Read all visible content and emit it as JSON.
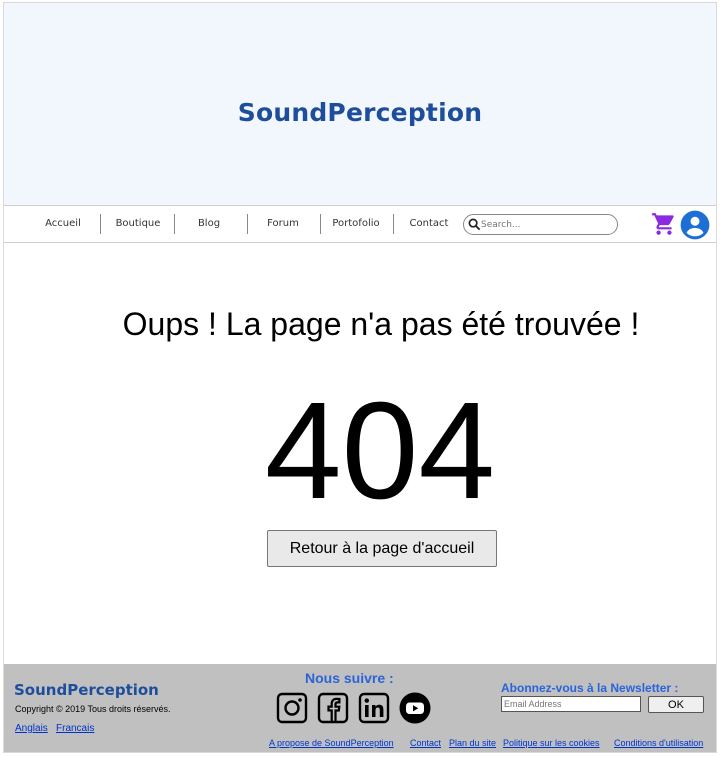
{
  "header": {
    "brand": "SoundPerception"
  },
  "nav": {
    "items": [
      "Accueil",
      "Boutique",
      "Blog",
      "Forum",
      "Portofolio",
      "Contact"
    ],
    "search_placeholder": "Search...",
    "cart_icon": "cart-icon",
    "user_icon": "user-account-icon",
    "accent_color": "#8a2be2",
    "user_color": "#1d6fd6"
  },
  "error": {
    "message": "Oups ! La page n'a pas été trouvée !",
    "code": "404",
    "home_button": "Retour à la page d'accueil"
  },
  "footer": {
    "brand": "SoundPerception",
    "copyright": "Copyright © 2019 Tous droits réservés.",
    "languages": [
      "Anglais",
      "Francais"
    ],
    "follow_title": "Nous suivre :",
    "socials": [
      "instagram-icon",
      "facebook-icon",
      "linkedin-icon",
      "youtube-icon"
    ],
    "newsletter_title": "Abonnez-vous à la Newsletter :",
    "email_placeholder": "Email Address",
    "ok_label": "OK",
    "links": [
      "A propose de SoundPerception",
      "Contact",
      "Plan du site",
      "Politique sur les cookies",
      "Conditions d'utilisation"
    ]
  }
}
